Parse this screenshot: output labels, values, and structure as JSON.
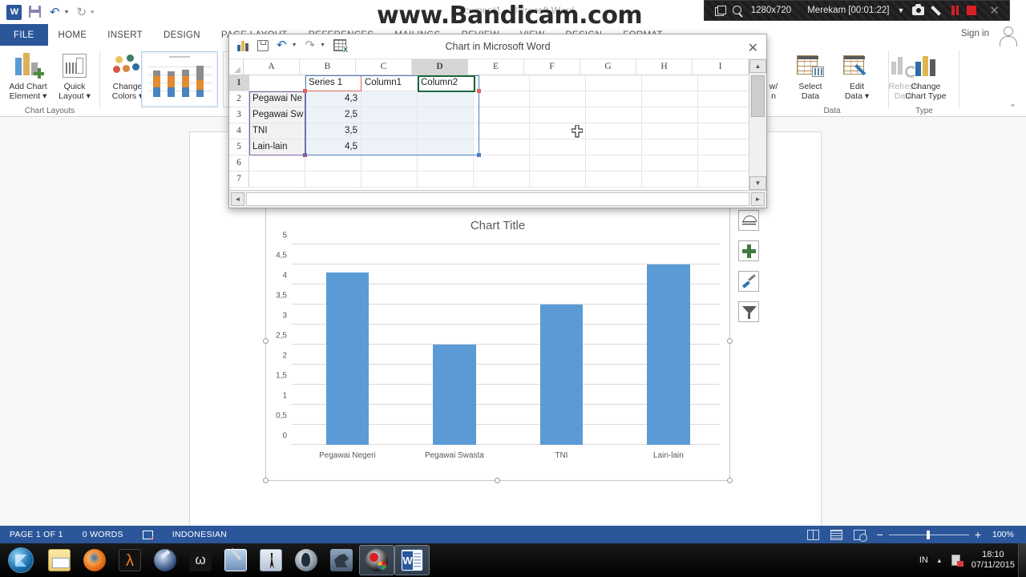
{
  "window": {
    "title": "Document1 - Microsoft Word",
    "sign_in": "Sign in"
  },
  "quick_access": {
    "items": [
      {
        "name": "word-logo",
        "label": "W"
      },
      {
        "name": "save-icon",
        "label": ""
      },
      {
        "name": "undo-icon",
        "label": "↶"
      },
      {
        "name": "redo-icon",
        "label": "↻"
      },
      {
        "name": "customize-qat-icon",
        "label": "≡"
      }
    ]
  },
  "tabs": [
    {
      "label": "FILE",
      "active": true
    },
    {
      "label": "HOME"
    },
    {
      "label": "INSERT"
    },
    {
      "label": "DESIGN"
    },
    {
      "label": "PAGE LAYOUT"
    },
    {
      "label": "REFERENCES"
    },
    {
      "label": "MAILINGS"
    },
    {
      "label": "REVIEW"
    },
    {
      "label": "VIEW"
    },
    {
      "label": "DESIGN"
    },
    {
      "label": "FORMAT"
    }
  ],
  "ribbon": {
    "groups": [
      {
        "name": "chart-layouts",
        "label": "Chart Layouts"
      },
      {
        "name": "chart-styles",
        "label": ""
      },
      {
        "name": "data",
        "label": "Data"
      },
      {
        "name": "type",
        "label": "Type"
      }
    ],
    "add_chart_element": {
      "line1": "Add Chart",
      "line2": "Element ▾"
    },
    "quick_layout": {
      "line1": "Quick",
      "line2": "Layout ▾"
    },
    "change_colors": {
      "line1": "Change",
      "line2": "Colors ▾"
    },
    "select_data": {
      "line1": "Select",
      "line2": "Data"
    },
    "edit_data": {
      "line1": "Edit",
      "line2": "Data ▾"
    },
    "refresh_data": {
      "line1": "Refresh",
      "line2": "Data"
    },
    "change_chart_type": {
      "line1": "Change",
      "line2": "Chart Type"
    },
    "switch_row_col": {
      "line1": "w/",
      "line2": "n"
    },
    "collapse": "⌃"
  },
  "excel": {
    "title": "Chart in Microsoft Word",
    "close_label": "✕",
    "toolbar": [
      "chart-icon",
      "save-icon",
      "undo-icon",
      "redo-icon",
      "edit-in-excel-icon"
    ],
    "columns": [
      "A",
      "B",
      "C",
      "D",
      "E",
      "F",
      "G",
      "H",
      "I"
    ],
    "active_column": "D",
    "row_numbers": [
      "1",
      "2",
      "3",
      "4",
      "5",
      "6",
      "7"
    ],
    "active_row": "1",
    "rows": [
      [
        "",
        "Series 1",
        "Column1",
        "Column2",
        "",
        "",
        "",
        "",
        ""
      ],
      [
        "Pegawai Ne",
        "4,3",
        "",
        "",
        "",
        "",
        "",
        "",
        ""
      ],
      [
        "Pegawai Sw",
        "2,5",
        "",
        "",
        "",
        "",
        "",
        "",
        ""
      ],
      [
        "TNI",
        "3,5",
        "",
        "",
        "",
        "",
        "",
        "",
        ""
      ],
      [
        "Lain-lain",
        "4,5",
        "",
        "",
        "",
        "",
        "",
        "",
        ""
      ],
      [
        "",
        "",
        "",
        "",
        "",
        "",
        "",
        "",
        ""
      ],
      [
        "",
        "",
        "",
        "",
        "",
        "",
        "",
        "",
        ""
      ]
    ],
    "scroll_up": "▲",
    "scroll_down": "▼",
    "scroll_left": "◄",
    "scroll_right": "►"
  },
  "chart_data": {
    "type": "bar",
    "title": "Chart Title",
    "categories": [
      "Pegawai Negeri",
      "Pegawai Swasta",
      "TNI",
      "Lain-lain"
    ],
    "series": [
      {
        "name": "Series 1",
        "values": [
          4.3,
          2.5,
          3.5,
          4.5
        ]
      }
    ],
    "values": [
      4.3,
      2.5,
      3.5,
      4.5
    ],
    "yticks": [
      "0",
      "0,5",
      "1",
      "1,5",
      "2",
      "2,5",
      "3",
      "3,5",
      "4",
      "4,5",
      "5"
    ],
    "ytick_values": [
      0,
      0.5,
      1,
      1.5,
      2,
      2.5,
      3,
      3.5,
      4,
      4.5,
      5
    ],
    "ylim": [
      0,
      5
    ],
    "xlabel": "",
    "ylabel": "",
    "grid": true,
    "legend": "none",
    "bar_color": "#5b9bd5"
  },
  "chart_side_buttons": [
    {
      "name": "layout-options-icon",
      "title": "Layout Options"
    },
    {
      "name": "chart-elements-icon",
      "title": "Chart Elements"
    },
    {
      "name": "chart-styles-icon",
      "title": "Chart Styles"
    },
    {
      "name": "chart-filters-icon",
      "title": "Chart Filters"
    }
  ],
  "status_bar": {
    "page": "PAGE 1 OF 1",
    "words": "0 WORDS",
    "proofing_icon": "proofing-errors-icon",
    "language": "INDONESIAN",
    "views": [
      "read-mode-icon",
      "print-layout-icon",
      "web-layout-icon"
    ],
    "zoom_out": "−",
    "zoom_in": "+",
    "zoom_level": "100%"
  },
  "taskbar": {
    "start": "start-orb-icon",
    "items": [
      {
        "name": "windows-explorer-icon"
      },
      {
        "name": "firefox-icon"
      },
      {
        "name": "half-life-icon"
      },
      {
        "name": "half-life-2-icon"
      },
      {
        "name": "warcraft-icon"
      },
      {
        "name": "sword-game-icon"
      },
      {
        "name": "counter-strike-icon"
      },
      {
        "name": "call-of-duty-icon"
      },
      {
        "name": "eagle-game-icon"
      },
      {
        "name": "bandicam-icon",
        "active": true
      },
      {
        "name": "microsoft-word-icon",
        "active": true
      }
    ],
    "tray": {
      "language": "IN",
      "caret": "▲",
      "time": "18:10",
      "date": "07/11/2015"
    }
  },
  "bandicam": {
    "resolution": "1280x720",
    "status": "Merekam [00:01:22]",
    "caret": "▼",
    "close": "✕",
    "watermark": "www.Bandicam.com"
  }
}
